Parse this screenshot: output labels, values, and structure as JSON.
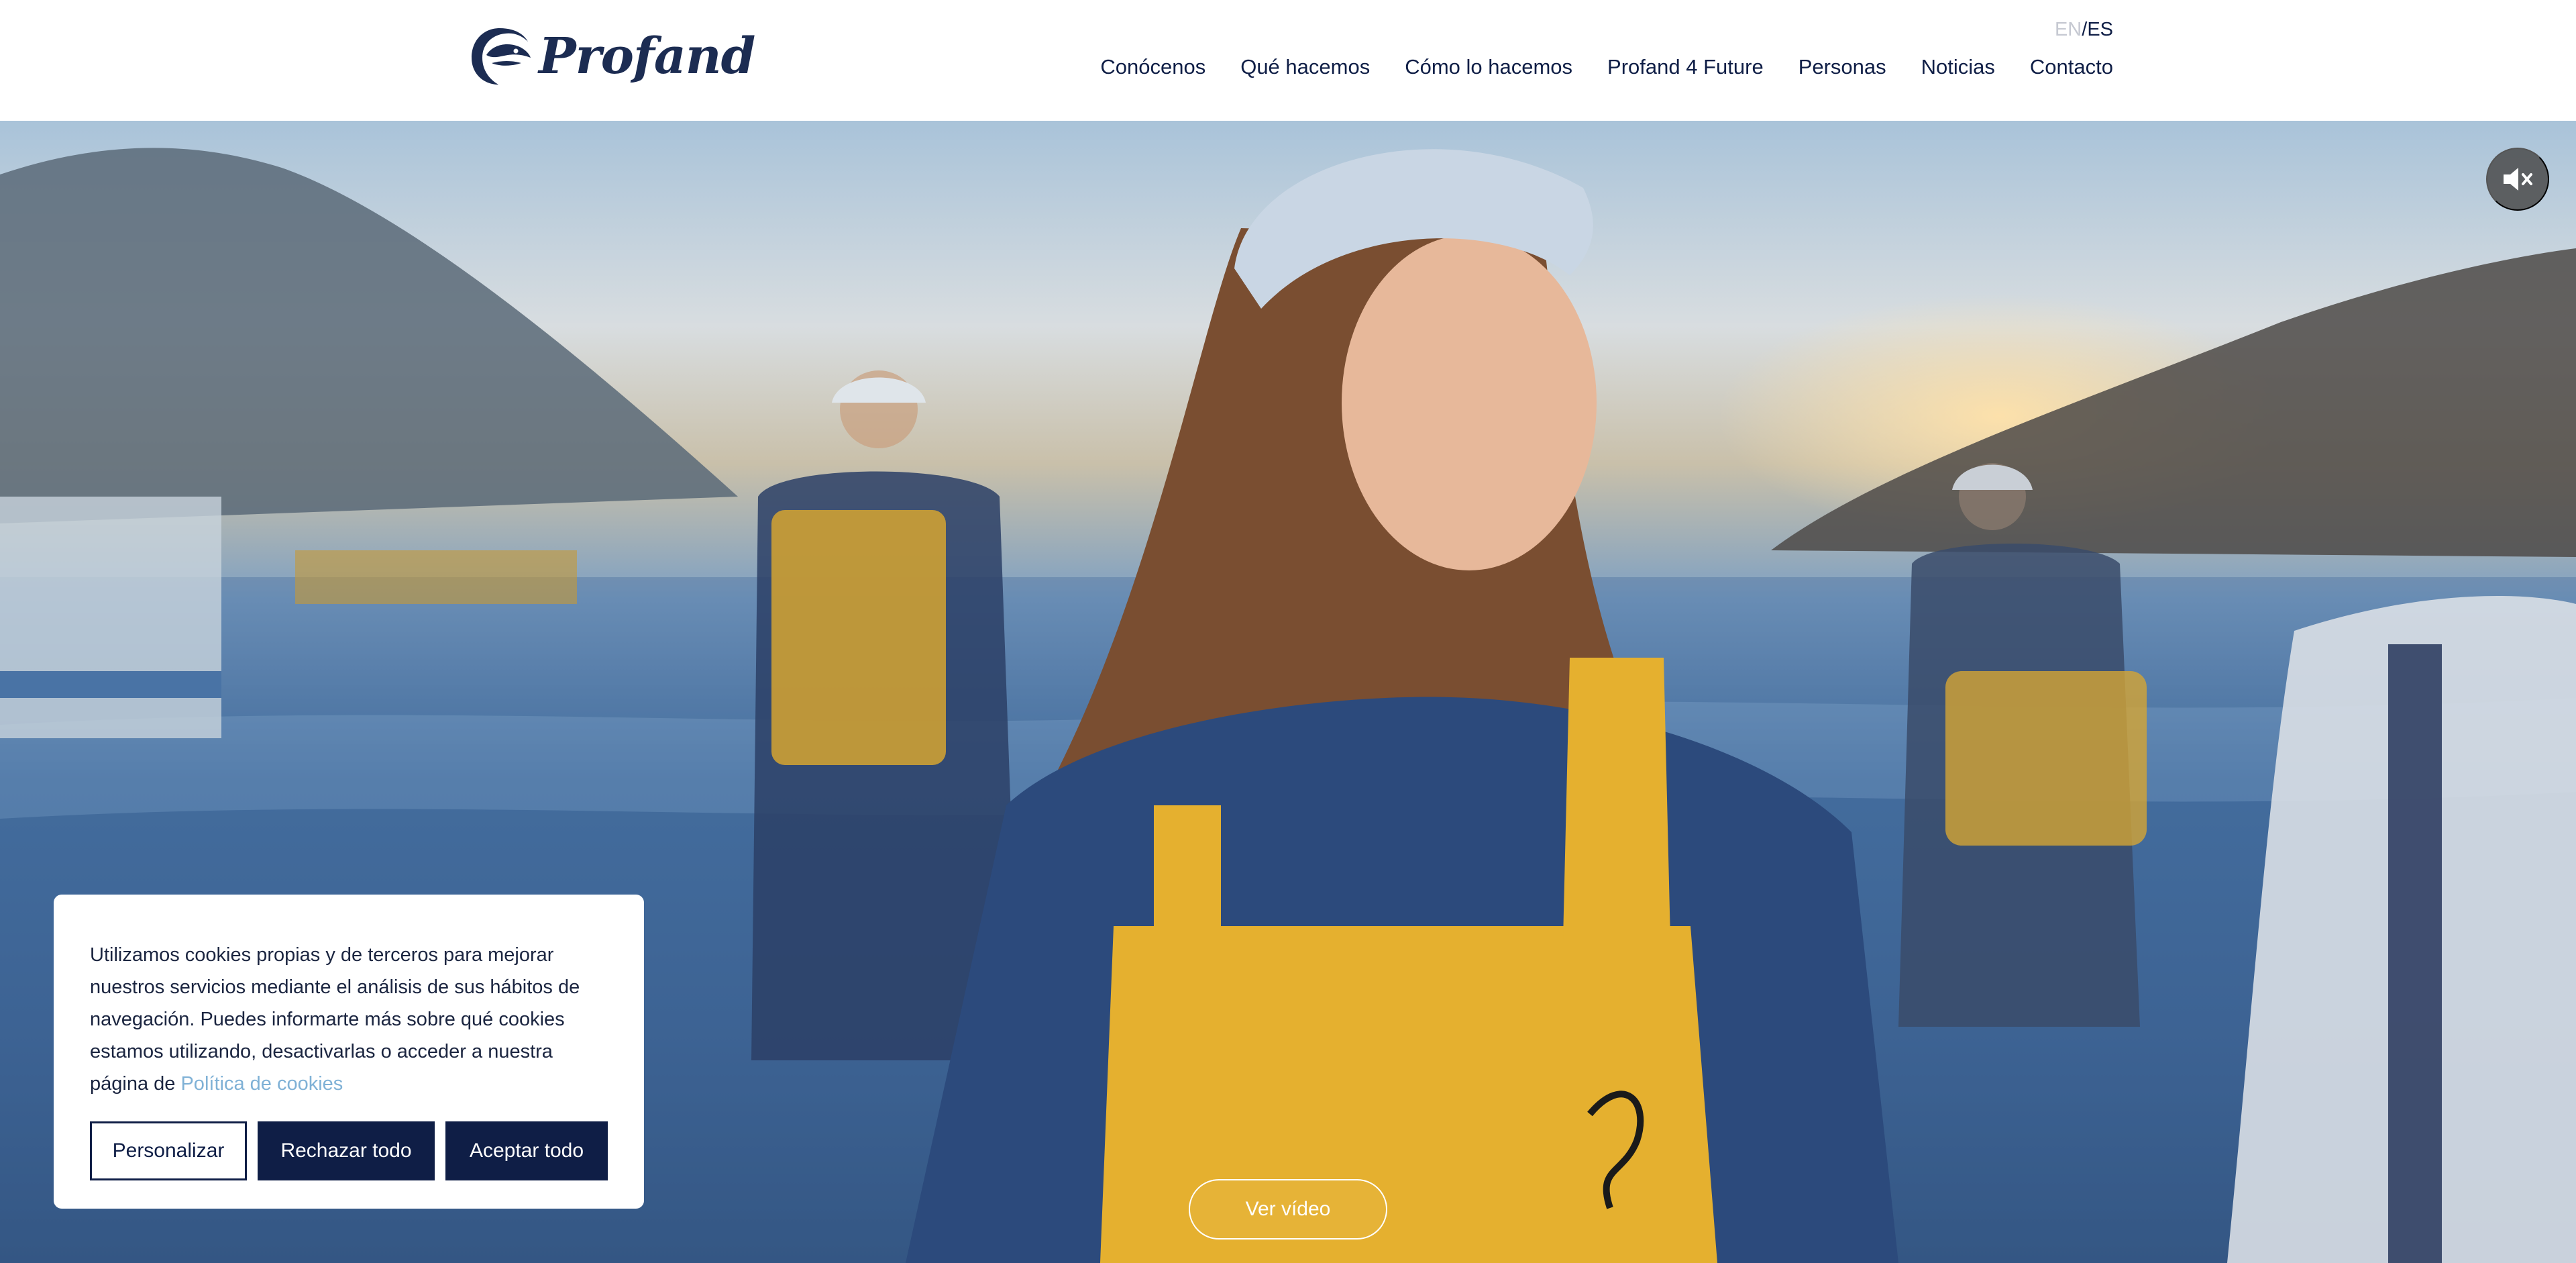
{
  "brand": {
    "name": "Profand",
    "navy": "#0f1e46",
    "accent_yellow": "#e7b12e",
    "link_blue": "#7fb1d6"
  },
  "language": {
    "en": "EN",
    "separator": "/",
    "es": "ES",
    "selected": "ES"
  },
  "nav": {
    "items": [
      {
        "label": "Conócenos"
      },
      {
        "label": "Qué hacemos"
      },
      {
        "label": "Cómo lo hacemos"
      },
      {
        "label": "Profand 4 Future"
      },
      {
        "label": "Personas"
      },
      {
        "label": "Noticias"
      },
      {
        "label": "Contacto"
      }
    ]
  },
  "hero": {
    "mute_icon": "speaker-muted-icon",
    "watch_video_label": "Ver vídeo"
  },
  "cookie_banner": {
    "text": "Utilizamos cookies propias y de terceros para mejorar nuestros servicios mediante el análisis de sus hábitos de navegación. Puedes informarte más sobre qué cookies estamos utilizando, desactivarlas o acceder a nuestra página de",
    "policy_link": "Política de cookies",
    "customize_label": "Personalizar",
    "reject_label": "Rechazar todo",
    "accept_label": "Aceptar todo"
  }
}
